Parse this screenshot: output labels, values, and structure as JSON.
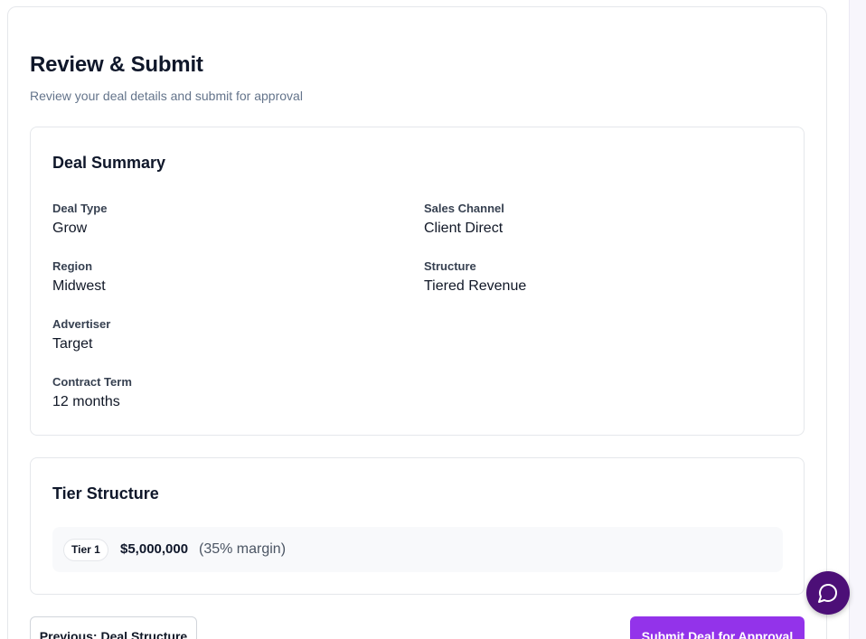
{
  "header": {
    "title": "Review & Submit",
    "subtitle": "Review your deal details and submit for approval"
  },
  "summary": {
    "title": "Deal Summary",
    "fields": [
      {
        "label": "Deal Type",
        "value": "Grow"
      },
      {
        "label": "Sales Channel",
        "value": "Client Direct"
      },
      {
        "label": "Region",
        "value": "Midwest"
      },
      {
        "label": "Structure",
        "value": "Tiered Revenue"
      },
      {
        "label": "Advertiser",
        "value": "Target"
      },
      {
        "label": "Contract Term",
        "value": "12 months"
      }
    ]
  },
  "tiers": {
    "title": "Tier Structure",
    "items": [
      {
        "badge": "Tier 1",
        "amount": "$5,000,000",
        "margin": "(35% margin)"
      }
    ]
  },
  "footer": {
    "previous_label": "Previous: Deal Structure",
    "submit_label": "Submit Deal for Approval"
  },
  "chat": {
    "icon": "chat-bubble-icon"
  },
  "colors": {
    "accent": "#9333ea",
    "chat_button": "#4c0f77"
  }
}
